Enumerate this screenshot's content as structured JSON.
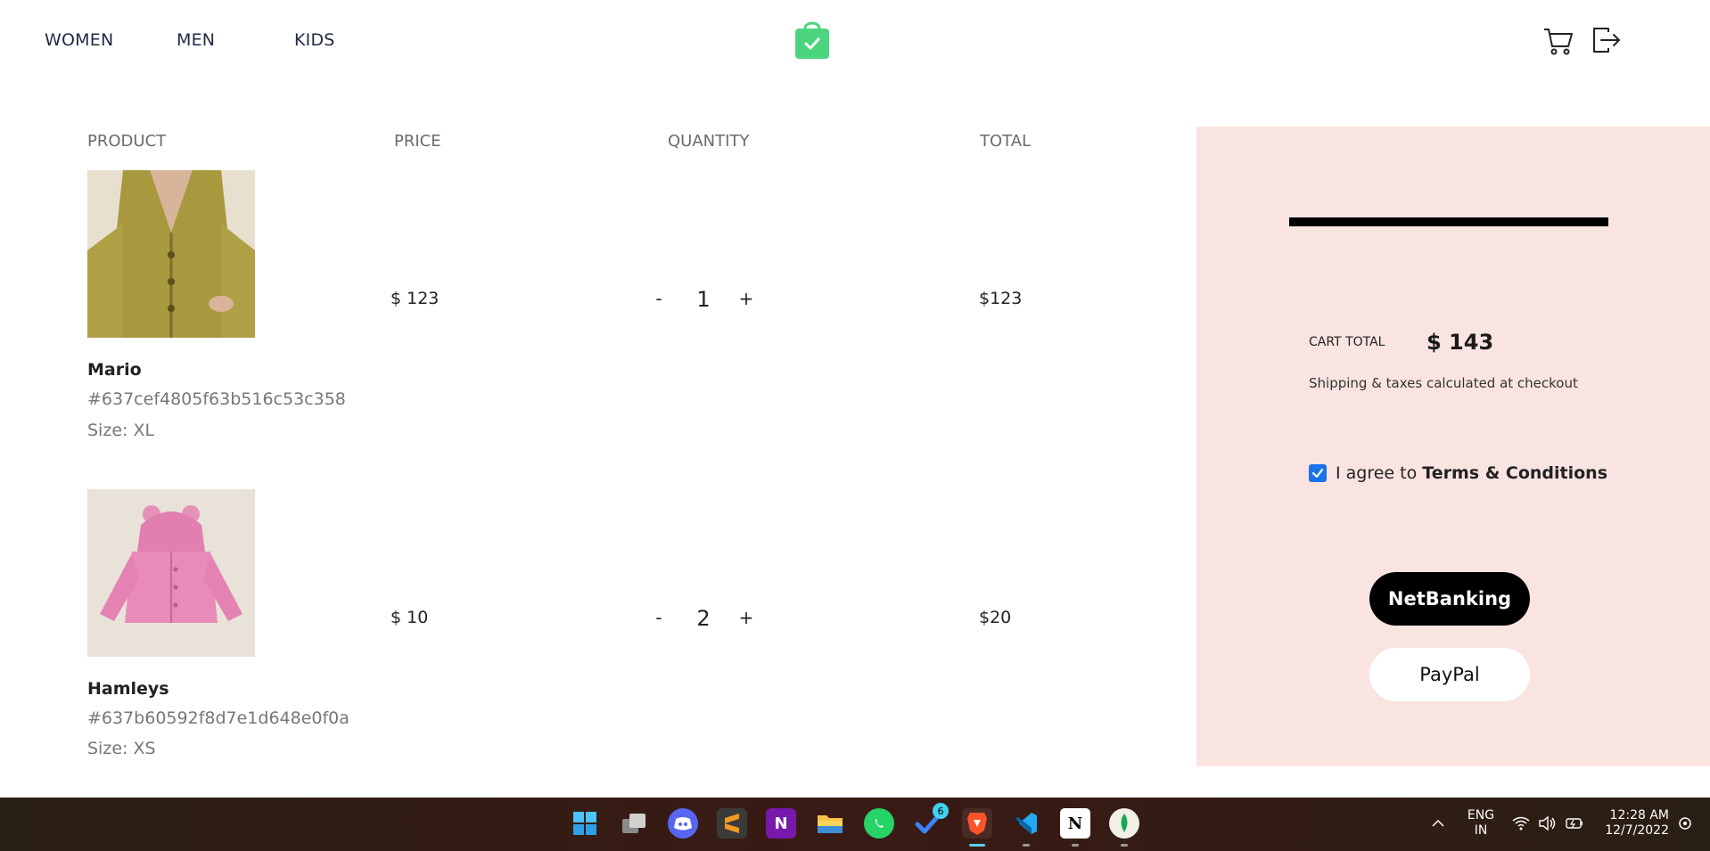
{
  "nav": {
    "women": "WOMEN",
    "men": "MEN",
    "kids": "KIDS"
  },
  "columns": {
    "product": "PRODUCT",
    "price": "PRICE",
    "quantity": "QUANTITY",
    "total": "TOTAL"
  },
  "cart_items": [
    {
      "name": "Mario",
      "id": "#637cef4805f63b516c53c358",
      "size": "Size: XL",
      "price": "$ 123",
      "qty_minus": "-",
      "quantity": "1",
      "qty_plus": "+",
      "total": "$123",
      "image_icon": "mustard-cardigan-photo"
    },
    {
      "name": "Hamleys",
      "id": "#637b60592f8d7e1d648e0f0a",
      "size": "Size: XS",
      "price": "$ 10",
      "qty_minus": "-",
      "quantity": "2",
      "qty_plus": "+",
      "total": "$20",
      "image_icon": "pink-kids-hoodie-photo"
    }
  ],
  "summary": {
    "cart_total_label": "CART TOTAL",
    "cart_total_value": "$ 143",
    "shipping_note": "Shipping & taxes calculated at checkout",
    "agree_prefix": "I agree to ",
    "agree_link": "Terms & Conditions",
    "agree_checked": true,
    "netbanking": "NetBanking",
    "paypal": "PayPal"
  },
  "taskbar": {
    "badge_count": "6",
    "lang_line1": "ENG",
    "lang_line2": "IN",
    "time": "12:28 AM",
    "date": "12/7/2022"
  },
  "colors": {
    "summary_bg": "#f9e4e1",
    "logo_green": "#4cd57e",
    "checkbox_blue": "#1a73e8"
  }
}
